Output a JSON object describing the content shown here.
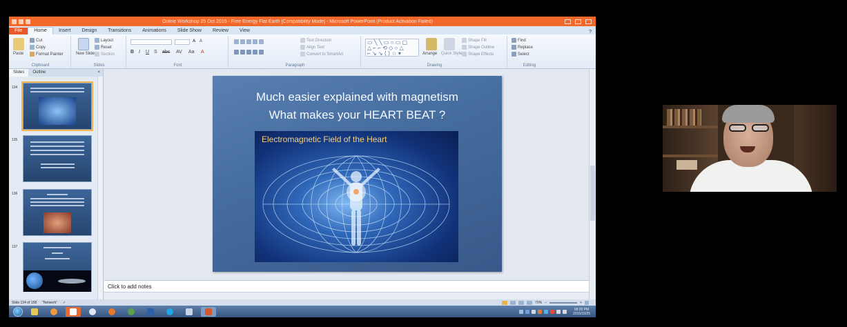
{
  "window": {
    "title": "Online Workshop 25 Oct 2015 - Free Energy Flat Earth [Compatibility Mode] - Microsoft PowerPoint (Product Activation Failed)"
  },
  "ribbon_tabs": [
    "File",
    "Home",
    "Insert",
    "Design",
    "Transitions",
    "Animations",
    "Slide Show",
    "Review",
    "View"
  ],
  "ribbon": {
    "clipboard": {
      "label": "Clipboard",
      "paste": "Paste",
      "cut": "Cut",
      "copy": "Copy",
      "format_painter": "Format Painter"
    },
    "slides": {
      "label": "Slides",
      "new_slide": "New Slide",
      "layout": "Layout",
      "reset": "Reset",
      "section": "Section"
    },
    "font": {
      "label": "Font"
    },
    "paragraph": {
      "label": "Paragraph",
      "text_direction": "Text Direction",
      "align_text": "Align Text",
      "smartart": "Convert to SmartArt"
    },
    "drawing": {
      "label": "Drawing",
      "arrange": "Arrange",
      "quick_styles": "Quick Styles",
      "shape_fill": "Shape Fill",
      "shape_outline": "Shape Outline",
      "shape_effects": "Shape Effects"
    },
    "editing": {
      "label": "Editing",
      "find": "Find",
      "replace": "Replace",
      "select": "Select"
    }
  },
  "panel": {
    "tabs": [
      "Slides",
      "Outline"
    ],
    "thumbs": [
      {
        "num": "134"
      },
      {
        "num": "135"
      },
      {
        "num": "136"
      },
      {
        "num": "137"
      }
    ]
  },
  "slide": {
    "title_line1": "Much easier explained with magnetism",
    "title_line2": "What makes your HEART BEAT ?",
    "image_caption": "Electromagnetic Field of the Heart"
  },
  "notes": {
    "placeholder": "Click to add notes"
  },
  "status": {
    "slide_info": "Slide 134 of 158",
    "theme": "\"Network\"",
    "zoom": "70%"
  },
  "clock": {
    "time": "08:20 PM",
    "date": "2015/10/25"
  },
  "colors": {
    "accent": "#f4682a",
    "slide_bg": "#466d9f",
    "caption": "#f6d27a"
  }
}
